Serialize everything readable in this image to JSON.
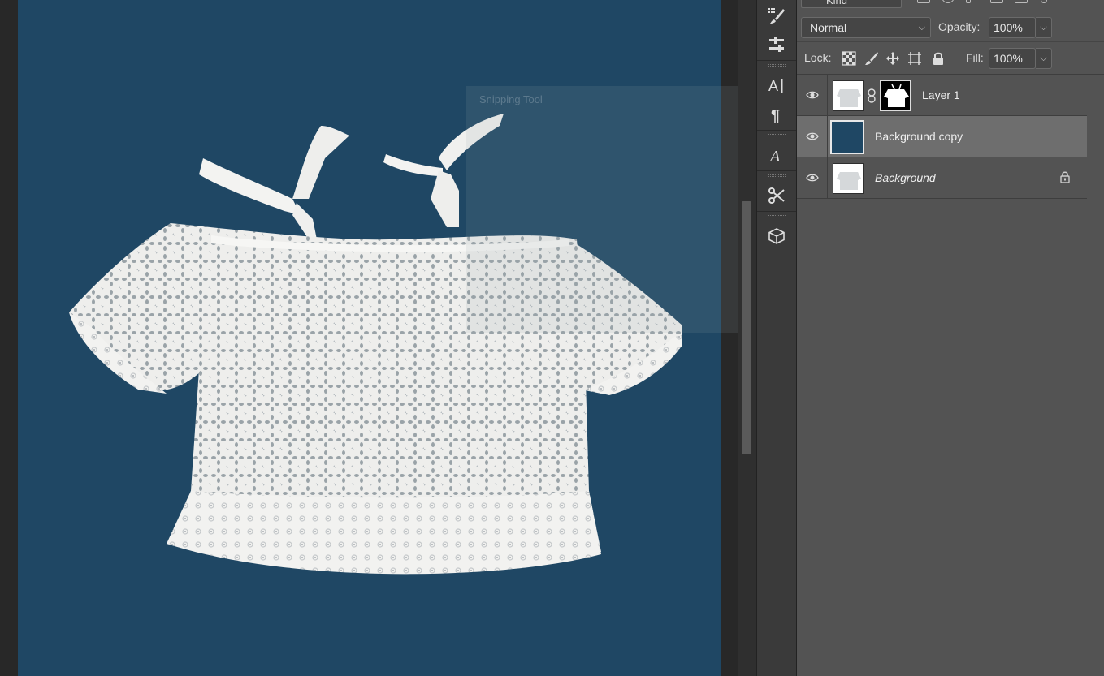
{
  "layers_panel": {
    "filter": {
      "kind_label": "Kind"
    },
    "blend_mode": "Normal",
    "opacity_label": "Opacity:",
    "opacity_value": "100%",
    "lock_label": "Lock:",
    "fill_label": "Fill:",
    "fill_value": "100%",
    "layers": [
      {
        "name": "Layer 1",
        "visible": true,
        "selected": false,
        "has_mask": true,
        "locked": false
      },
      {
        "name": "Background copy",
        "visible": true,
        "selected": true,
        "has_mask": false,
        "locked": false
      },
      {
        "name": "Background",
        "visible": true,
        "selected": false,
        "has_mask": false,
        "locked": true
      }
    ]
  },
  "tool_strip": {
    "tools": [
      "history-brush-icon",
      "adjustments-icon",
      "character-icon",
      "paragraph-icon",
      "glyphs-icon",
      "tool-presets-icon",
      "3d-icon"
    ]
  },
  "snipping_tool": {
    "title": "Snipping Tool"
  },
  "colors": {
    "canvas_background": "#1f4764",
    "panel_background": "#535353",
    "selected_row": "#6e6e6e"
  }
}
